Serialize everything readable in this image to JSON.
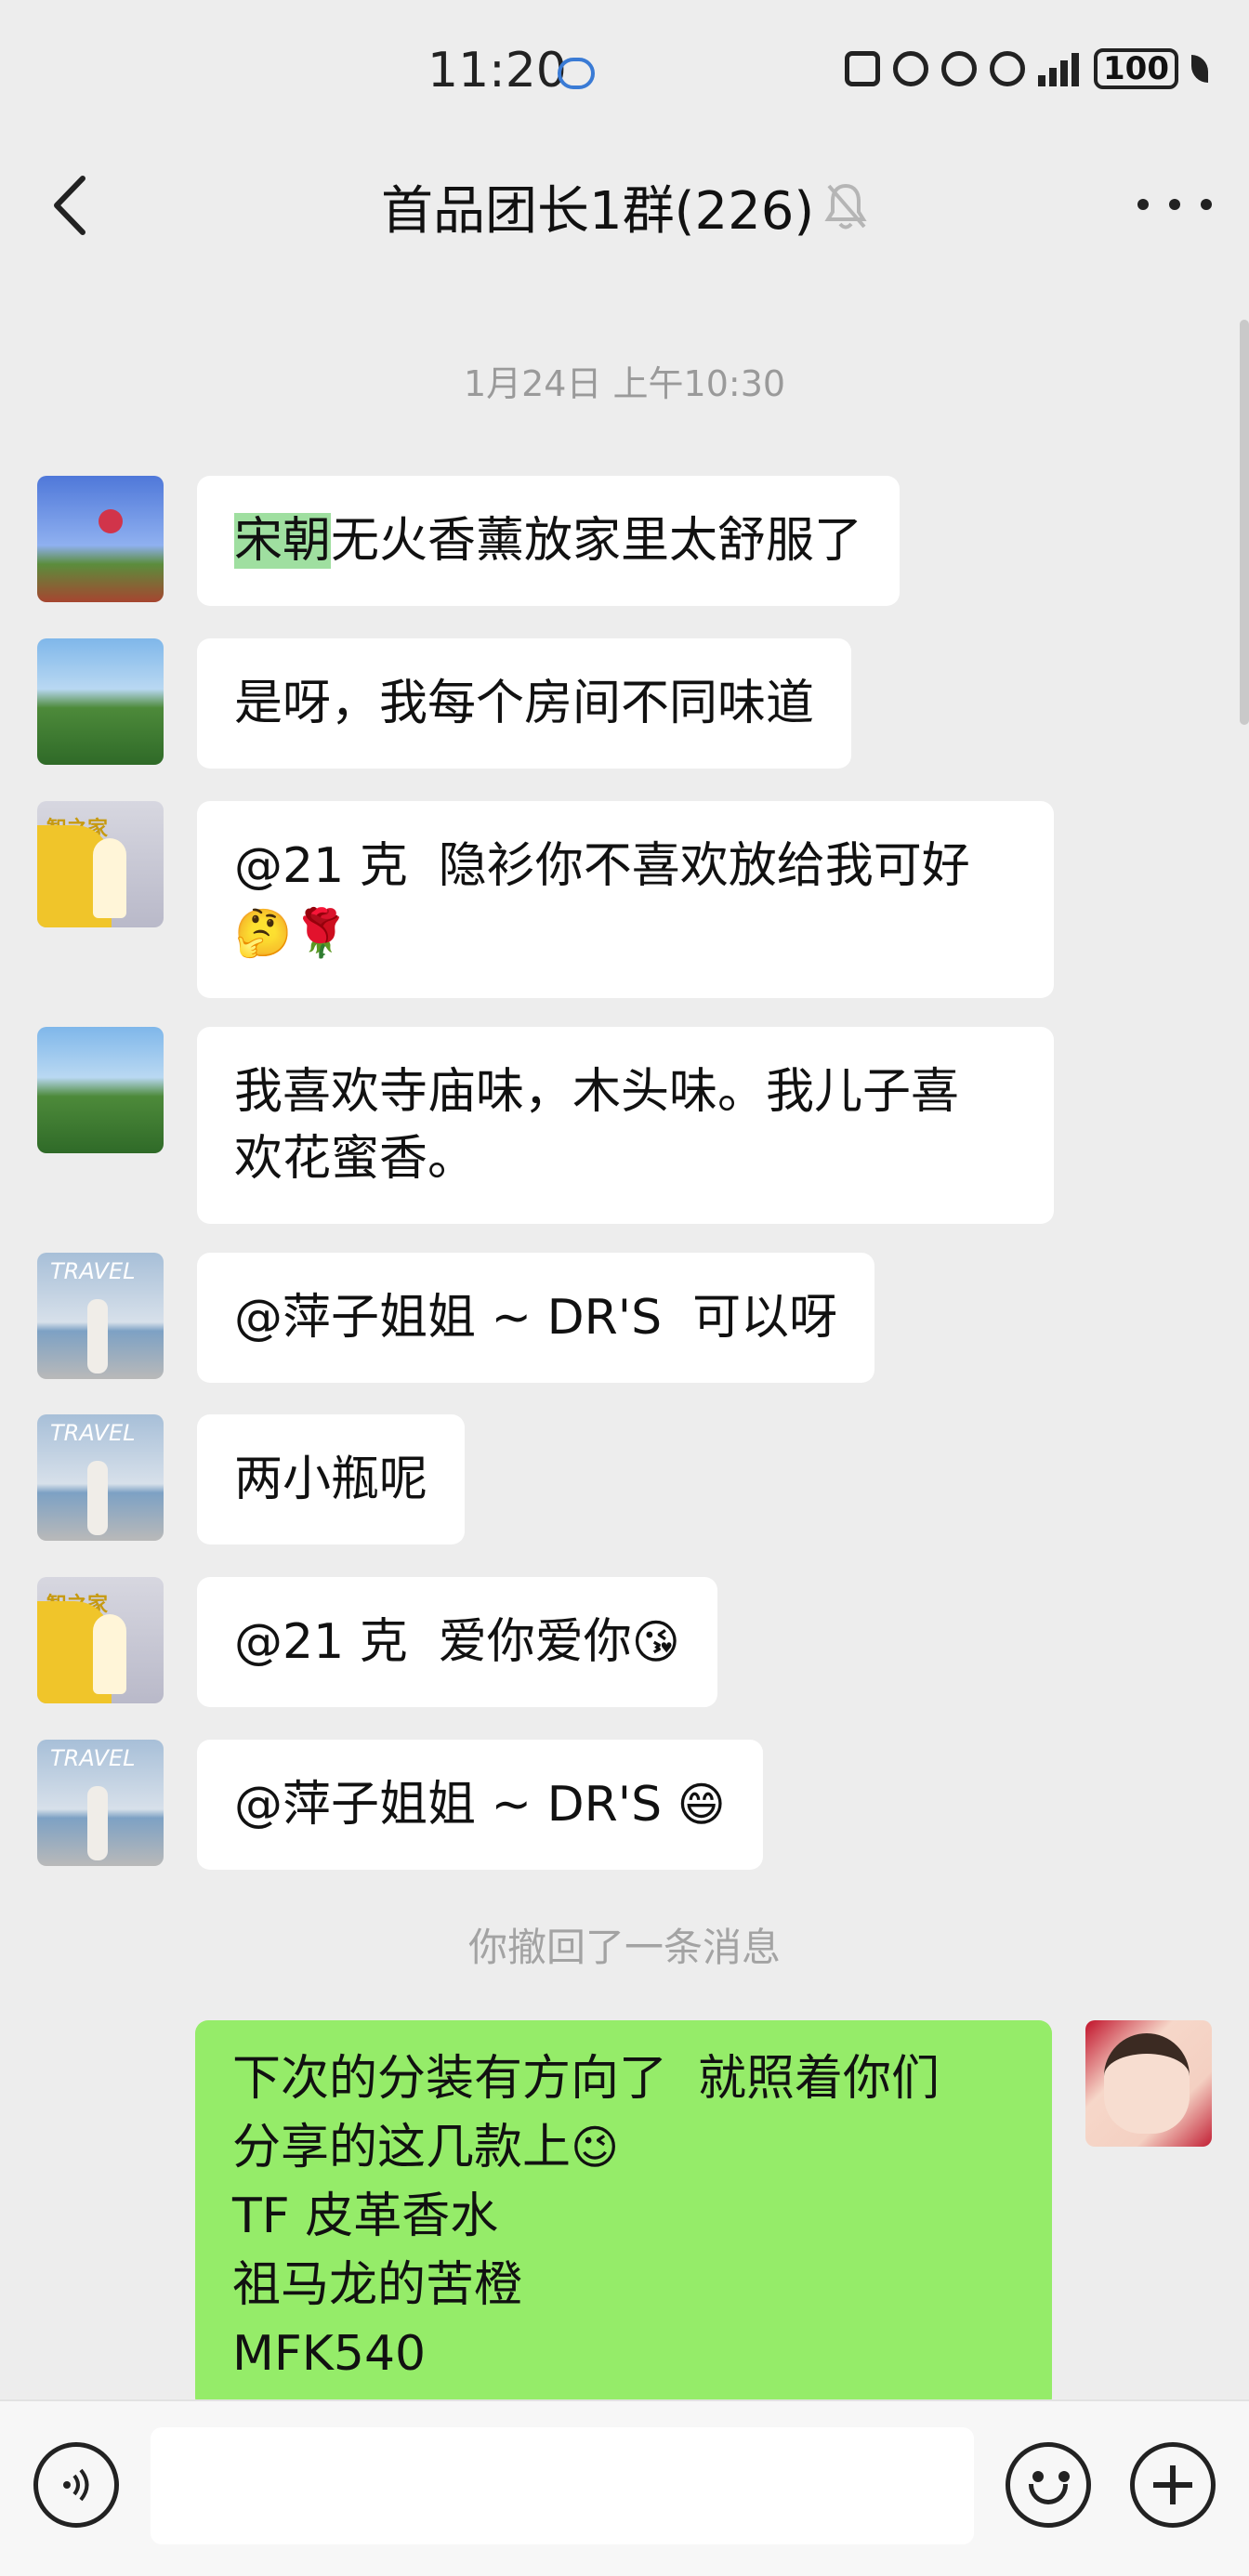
{
  "status_bar": {
    "time": "11:20",
    "battery": "100",
    "network": "4G"
  },
  "header": {
    "title": "首品团长1群(226)"
  },
  "timestamp": "1月24日 上午10:30",
  "messages": [
    {
      "highlight": "宋朝",
      "text": "无火香薰放家里太舒服了"
    },
    {
      "text": "是呀，我每个房间不同味道"
    },
    {
      "text": "@21 克  隐衫你不喜欢放给我可好",
      "emoji": "🤔🌹"
    },
    {
      "text": "我喜欢寺庙味，木头味。我儿子喜\n欢花蜜香。"
    },
    {
      "text": "@萍子姐姐 ~ DR'S  可以呀"
    },
    {
      "text": "两小瓶呢"
    },
    {
      "text": "@21 克  爱你爱你",
      "emoji": "😘"
    },
    {
      "text": "@萍子姐姐 ~ DR'S",
      "emoji": "😄"
    }
  ],
  "recall_notice": "你撤回了一条消息",
  "my_message": {
    "text": "下次的分装有方向了  就照着你们\n分享的这几款上",
    "emoji": "😉",
    "lines": [
      "TF 皮革香水",
      "祖马龙的苦橙",
      "MFK540"
    ]
  },
  "avatar_labels": {
    "poster": "智之家",
    "travel": "TRAVEL"
  },
  "colors": {
    "background": "#ededed",
    "my_bubble": "#95ec69",
    "other_bubble": "#ffffff",
    "highlight": "#9fdfa0"
  }
}
